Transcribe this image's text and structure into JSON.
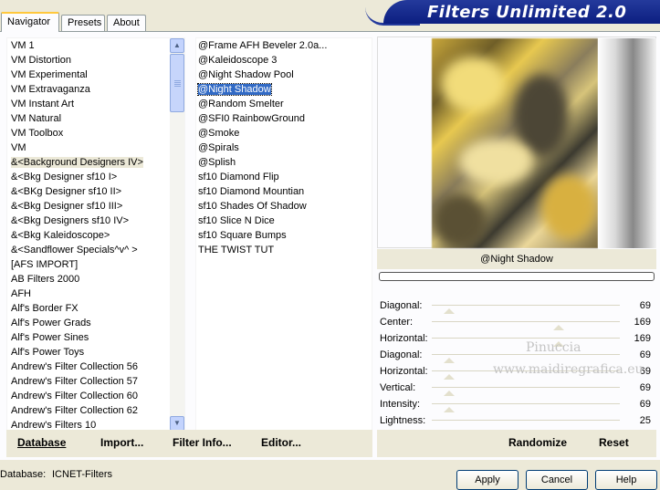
{
  "tabs": [
    {
      "label": "Navigator",
      "active": true
    },
    {
      "label": "Presets",
      "active": false
    },
    {
      "label": "About",
      "active": false
    }
  ],
  "banner": {
    "title": "Filters Unlimited 2.0"
  },
  "categories": [
    "VM 1",
    "VM Distortion",
    "VM Experimental",
    "VM Extravaganza",
    "VM Instant Art",
    "VM Natural",
    "VM Toolbox",
    "VM",
    "&<Background Designers IV>",
    "&<Bkg Designer sf10 I>",
    "&<BKg Designer sf10 II>",
    "&<Bkg Designer sf10 III>",
    "&<Bkg Designers sf10 IV>",
    "&<Bkg Kaleidoscope>",
    "&<Sandflower Specials^v^ >",
    "[AFS IMPORT]",
    "AB Filters 2000",
    "AFH",
    "Alf's Border FX",
    "Alf's Power Grads",
    "Alf's Power Sines",
    "Alf's Power Toys",
    "Andrew's Filter Collection 56",
    "Andrew's Filter Collection 57",
    "Andrew's Filter Collection 60",
    "Andrew's Filter Collection 62",
    "Andrew's Filters 10"
  ],
  "selected_category": "&<Background Designers IV>",
  "filters": [
    "@Frame AFH Beveler 2.0a...",
    "@Kaleidoscope 3",
    "@Night Shadow Pool",
    "@Night Shadow",
    "@Random Smelter",
    "@SFI0 RainbowGround",
    "@Smoke",
    "@Spirals",
    "@Splish",
    "sf10 Diamond Flip",
    "sf10 Diamond Mountian",
    "sf10 Shades Of Shadow",
    "sf10 Slice N Dice",
    "sf10 Square Bumps",
    "THE TWIST TUT"
  ],
  "selected_filter": "@Night Shadow",
  "preview": {
    "filter_name": "@Night Shadow"
  },
  "parameters": [
    {
      "label": "Diagonal:",
      "value": 69
    },
    {
      "label": "Center:",
      "value": 169
    },
    {
      "label": "Horizontal:",
      "value": 169
    },
    {
      "label": "Diagonal:",
      "value": 69
    },
    {
      "label": "Horizontal:",
      "value": 69
    },
    {
      "label": "Vertical:",
      "value": 69
    },
    {
      "label": "Intensity:",
      "value": 69
    },
    {
      "label": "Lightness:",
      "value": 25
    }
  ],
  "watermark": {
    "line1": "Pinuccia",
    "line2": "www.maidiregrafica.eu"
  },
  "toolbar": {
    "database": "Database",
    "import": "Import...",
    "filter_info": "Filter Info...",
    "editor": "Editor...",
    "randomize": "Randomize",
    "reset": "Reset"
  },
  "status": {
    "database_label": "Database:",
    "database_value": "ICNET-Filters"
  },
  "dialog_buttons": {
    "apply": "Apply",
    "cancel": "Cancel",
    "help": "Help"
  }
}
